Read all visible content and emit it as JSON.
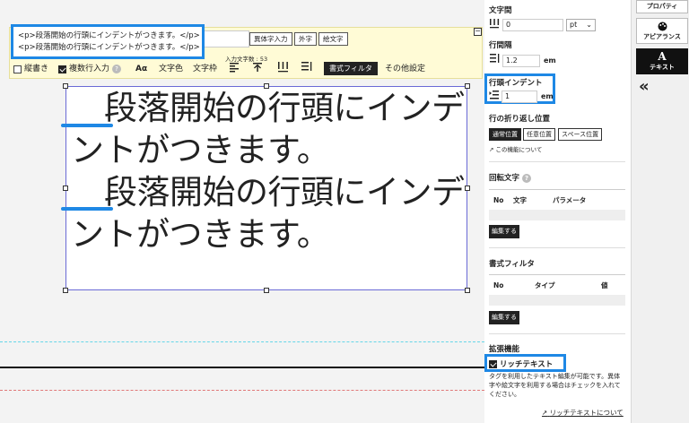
{
  "editor": {
    "html_lines": [
      "<p>段落開始の行頭にインデントがつきます。</p>",
      "<p>段落開始の行頭にインデントがつきます。</p>"
    ],
    "buttons": {
      "variant": "異体字入力",
      "external": "外字",
      "emoji": "絵文字"
    },
    "collapse": "−",
    "char_count": "入力文字数 : 53",
    "tools": {
      "vertical": "縦書き",
      "multiline": "複数行入力",
      "font_icon": "Aα",
      "text_color": "文字色",
      "text_frame": "文字枠",
      "filter": "書式フィルタ",
      "other": "その他設定"
    }
  },
  "textbox": {
    "paragraphs": [
      "段落開始の行頭にインデントがつきます。",
      "段落開始の行頭にインデントがつきます。"
    ]
  },
  "panel": {
    "letter_spacing": {
      "label": "文字間",
      "value": "0",
      "unit": "pt"
    },
    "line_spacing": {
      "label": "行間隔",
      "value": "1.2",
      "unit": "em"
    },
    "indent": {
      "label": "行頭インデント",
      "value": "1",
      "unit": "em"
    },
    "wrap": {
      "label": "行の折り返し位置",
      "options": [
        "通常位置",
        "任意位置",
        "スペース位置"
      ],
      "selected": "通常位置",
      "link": "この機能について"
    },
    "rotation": {
      "label": "回転文字",
      "columns": [
        "No",
        "文字",
        "パラメータ"
      ],
      "edit": "編集する"
    },
    "format_filter": {
      "label": "書式フィルタ",
      "columns": [
        "No",
        "タイプ",
        "値"
      ],
      "edit": "編集する"
    },
    "extension": {
      "label": "拡張機能",
      "rich_text": "リッチテキスト",
      "rich_text_checked": true,
      "desc": "タグを利用したテキスト編集が可能です。異体字や絵文字を利用する場合はチェックを入れてください。",
      "link": "リッチテキストについて"
    }
  },
  "right": {
    "property": "プロパティ",
    "appearance": "アピアランス",
    "text_icon": "A",
    "text": "テキスト",
    "collapse": "«"
  },
  "colors": {
    "highlight": "#1e88e5",
    "toolbar_bg": "#fffbd6",
    "selection": "#6a6ad6"
  }
}
